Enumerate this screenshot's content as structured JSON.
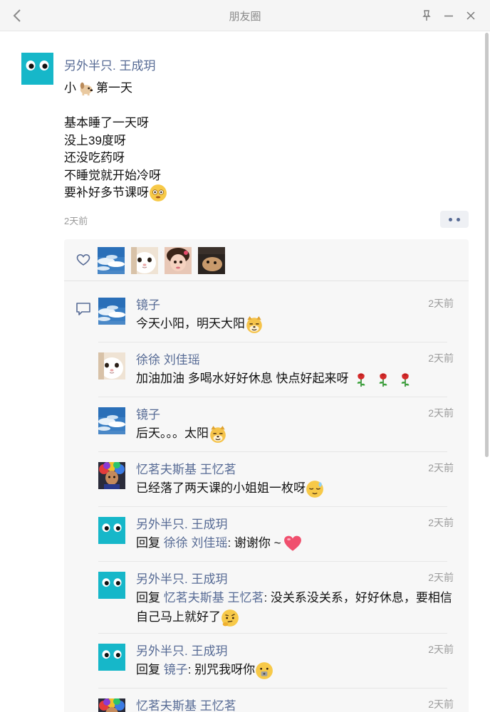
{
  "window": {
    "title": "朋友圈"
  },
  "post": {
    "author": "另外半只. 王成玥",
    "lines": [
      "小",
      "第一天",
      "",
      "基本睡了一天呀",
      "没上39度呀",
      "还没吃药呀",
      "不睡觉就开始冷呀",
      "要补好多节课呀"
    ],
    "time": "2天前"
  },
  "comments": [
    {
      "name": "镜子",
      "time": "2天前",
      "text": "今天小阳，明天大阳"
    },
    {
      "name": "徐徐 刘佳瑶",
      "time": "2天前",
      "text": "加油加油 多喝水好好休息 快点好起来呀"
    },
    {
      "name": "镜子",
      "time": "2天前",
      "text": "后天。。。太阳"
    },
    {
      "name": "忆茗夫斯基 王忆茗",
      "time": "2天前",
      "text": "已经落了两天课的小姐姐一枚呀"
    },
    {
      "name": "另外半只. 王成玥",
      "time": "2天前",
      "reply_prefix": "回复",
      "reply_to": "徐徐 刘佳瑶",
      "text": ": 谢谢你 ~"
    },
    {
      "name": "另外半只. 王成玥",
      "time": "2天前",
      "reply_prefix": "回复",
      "reply_to": "忆茗夫斯基 王忆茗",
      "text": ": 没关系没关系，好好休息，要相信自己马上就好了"
    },
    {
      "name": "另外半只. 王成玥",
      "time": "2天前",
      "reply_prefix": "回复",
      "reply_to": "镜子",
      "text": ": 别咒我呀你"
    },
    {
      "name": "忆茗夫斯基 王忆茗",
      "time": "2天前",
      "text": ""
    }
  ],
  "icons": {
    "back": "chevron-left-icon",
    "pin": "pin-icon",
    "minimize": "minimize-icon",
    "close": "close-icon",
    "like": "heart-outline-icon",
    "comment": "comment-bubble-icon",
    "more": "more-dots-icon"
  },
  "colors": {
    "link": "#576b95",
    "titlebar": "#f5f5f5",
    "panel": "#f7f7f7",
    "teal_avatar": "#16b7c9"
  }
}
